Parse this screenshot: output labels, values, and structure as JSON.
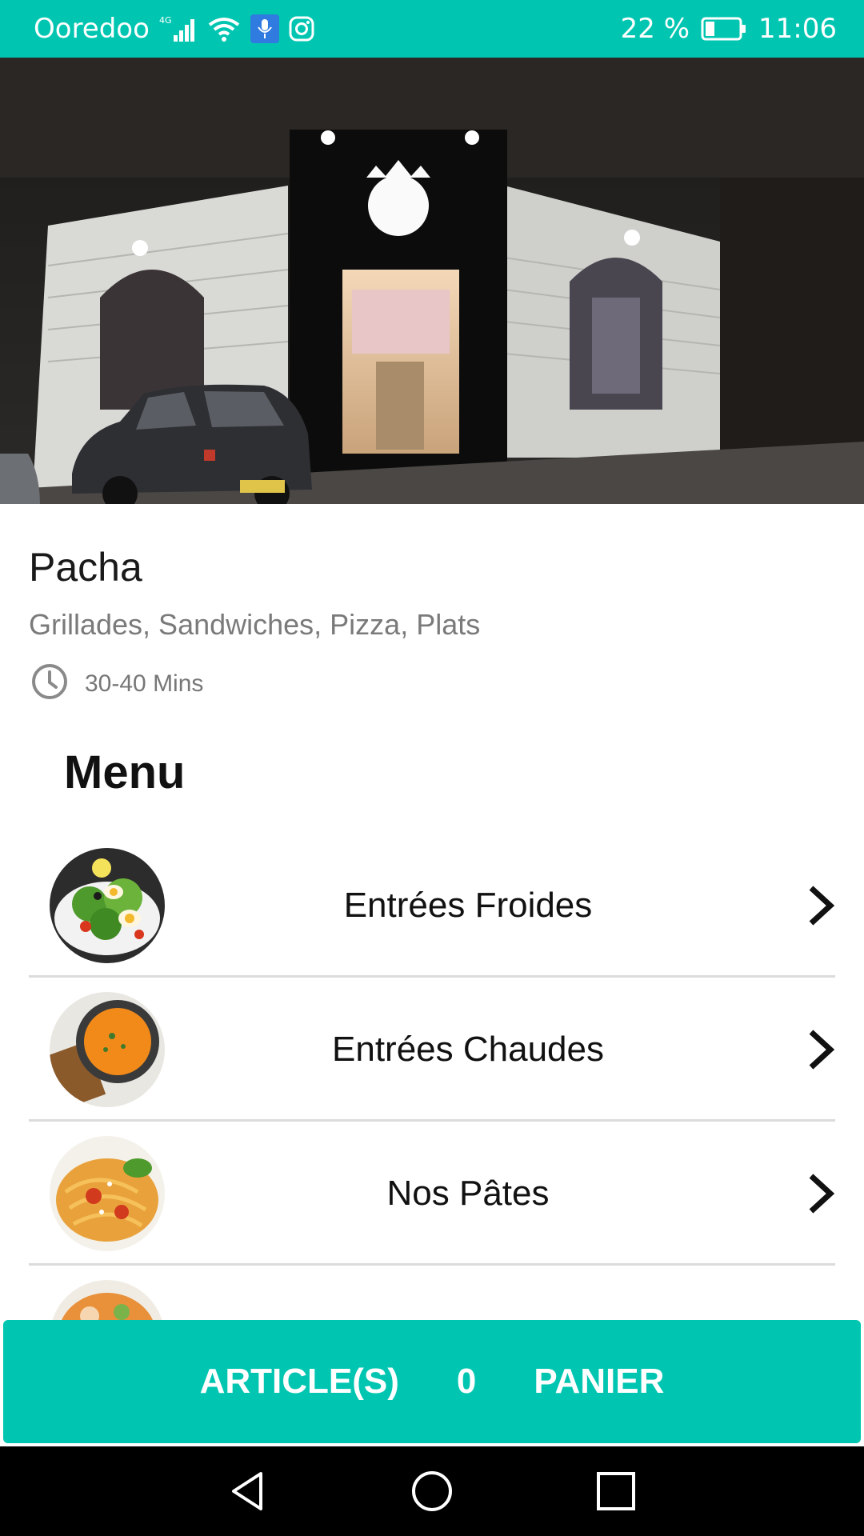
{
  "status_bar": {
    "carrier": "Ooredoo",
    "network_type": "4G",
    "battery_percent": "22 %",
    "time": "11:06",
    "icons": [
      "signal-icon",
      "wifi-icon",
      "mic-app-icon",
      "instagram-icon",
      "battery-icon"
    ]
  },
  "hero": {
    "image": "restaurant-storefront-photo"
  },
  "restaurant": {
    "name": "Pacha",
    "cuisines": "Grillades, Sandwiches, Pizza, Plats",
    "delivery_time": "30-40 Mins"
  },
  "menu": {
    "heading": "Menu",
    "items": [
      {
        "label": "Entrées Froides",
        "image": "salad-thumbnail"
      },
      {
        "label": "Entrées Chaudes",
        "image": "soup-thumbnail"
      },
      {
        "label": "Nos Pâtes",
        "image": "pasta-thumbnail"
      },
      {
        "label": "",
        "image": "partial-thumbnail"
      }
    ]
  },
  "cart": {
    "articles_label": "ARTICLE(S)",
    "count": "0",
    "cart_label": "PANIER"
  },
  "colors": {
    "accent": "#00c6b1",
    "nav_background": "#000000"
  }
}
